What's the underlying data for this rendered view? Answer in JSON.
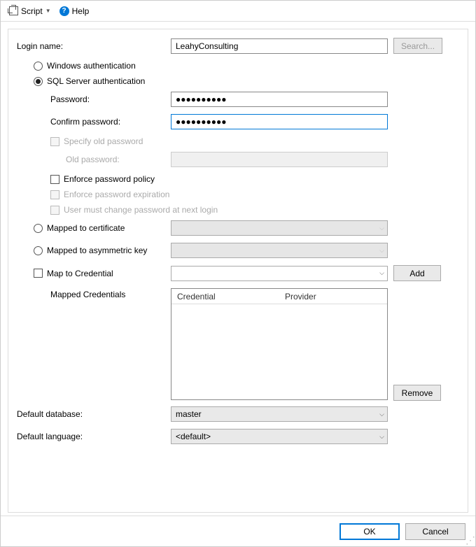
{
  "toolbar": {
    "script_label": "Script",
    "help_label": "Help"
  },
  "labels": {
    "login_name": "Login name:",
    "windows_auth": "Windows authentication",
    "sql_auth": "SQL Server authentication",
    "password": "Password:",
    "confirm_password": "Confirm password:",
    "specify_old": "Specify old password",
    "old_password": "Old password:",
    "enforce_policy": "Enforce password policy",
    "enforce_expiration": "Enforce password expiration",
    "must_change": "User must change password at next login",
    "mapped_cert": "Mapped to certificate",
    "mapped_asym": "Mapped to asymmetric key",
    "map_credential": "Map to Credential",
    "mapped_credentials": "Mapped Credentials",
    "default_database": "Default database:",
    "default_language": "Default language:"
  },
  "values": {
    "login_name": "LeahyConsulting",
    "password_mask": "●●●●●●●●●●",
    "confirm_password_mask": "●●●●●●●●●●",
    "default_database": "master",
    "default_language": "<default>"
  },
  "table": {
    "col_credential": "Credential",
    "col_provider": "Provider"
  },
  "buttons": {
    "search": "Search...",
    "add": "Add",
    "remove": "Remove",
    "ok": "OK",
    "cancel": "Cancel"
  }
}
